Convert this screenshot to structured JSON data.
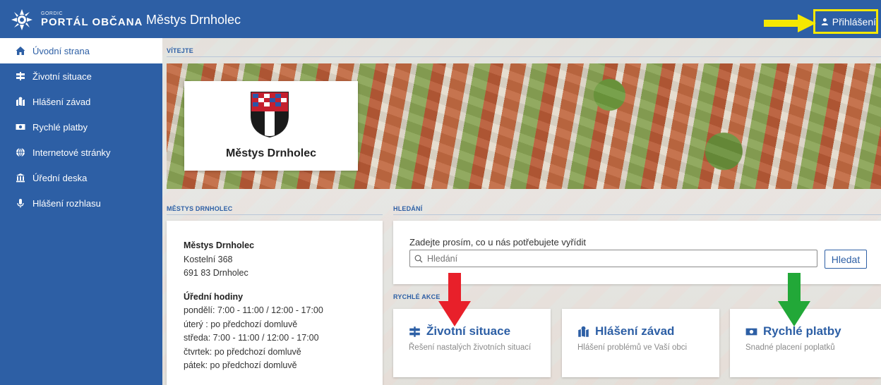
{
  "header": {
    "logo_small": "GORDIC",
    "logo_main": "PORTÁL OBČANA",
    "title": "Městys Drnholec",
    "login_label": "Přihlášení"
  },
  "sidebar": {
    "items": [
      {
        "label": "Úvodní strana",
        "icon": "home-icon"
      },
      {
        "label": "Životní situace",
        "icon": "signpost-icon"
      },
      {
        "label": "Hlášení závad",
        "icon": "map-report-icon"
      },
      {
        "label": "Rychlé platby",
        "icon": "money-icon"
      },
      {
        "label": "Internetové stránky",
        "icon": "globe-icon"
      },
      {
        "label": "Úřední deska",
        "icon": "institution-icon"
      },
      {
        "label": "Hlášení rozhlasu",
        "icon": "microphone-icon"
      }
    ]
  },
  "welcome": {
    "label": "VÍTEJTE",
    "banner_title": "Městys Drnholec"
  },
  "contact": {
    "section_label": "MĚSTYS DRNHOLEC",
    "name": "Městys Drnholec",
    "street": "Kostelní 368",
    "city": "691 83 Drnholec",
    "hours_title": "Úřední hodiny",
    "hours": [
      "pondělí: 7:00 - 11:00 / 12:00 - 17:00",
      "úterý : po předchozí domluvě",
      "středa: 7:00 - 11:00 / 12:00 - 17:00",
      "čtvrtek: po předchozí domluvě",
      "pátek: po předchozí domluvě"
    ]
  },
  "search": {
    "section_label": "HLEDÁNÍ",
    "prompt": "Zadejte prosím, co u nás potřebujete vyřídit",
    "placeholder": "Hledání",
    "button_label": "Hledat"
  },
  "quick_actions": {
    "section_label": "RYCHLÉ AKCE",
    "items": [
      {
        "title": "Životní situace",
        "desc": "Řešení nastalých životních situací",
        "icon": "signpost-icon"
      },
      {
        "title": "Hlášení závad",
        "desc": "Hlášení problémů ve Vaší obci",
        "icon": "map-report-icon"
      },
      {
        "title": "Rychlé platby",
        "desc": "Snadné placení poplatků",
        "icon": "money-icon"
      }
    ]
  },
  "colors": {
    "brand": "#2d5fa5",
    "highlight_yellow": "#f5e800",
    "arrow_red": "#e8202a",
    "arrow_green": "#22a838"
  }
}
